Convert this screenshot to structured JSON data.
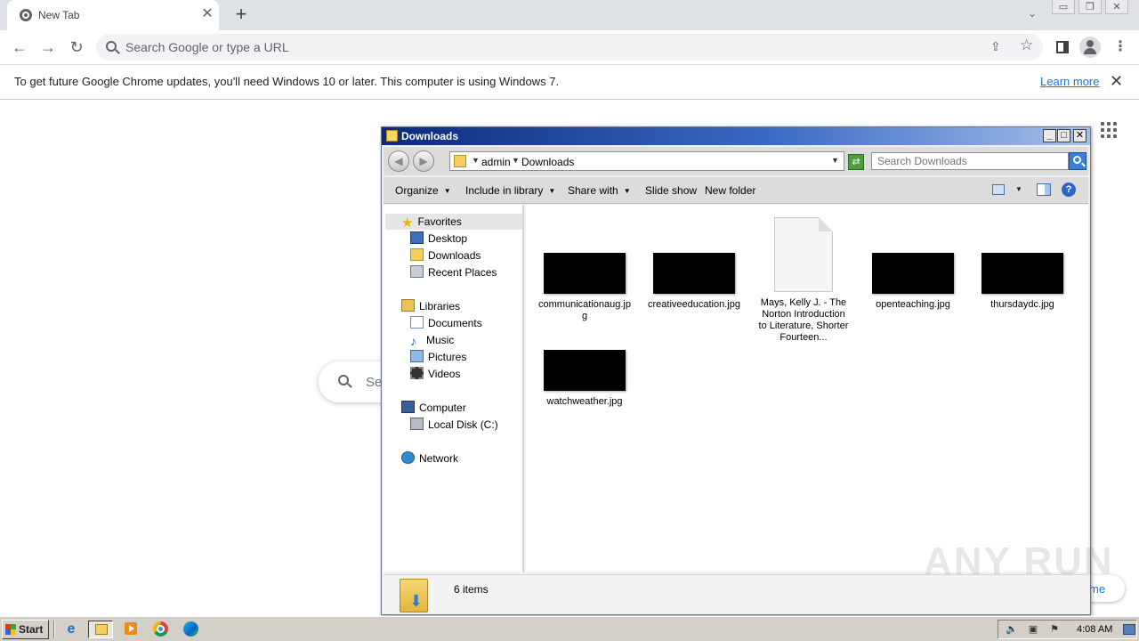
{
  "browser": {
    "tab_title": "New Tab",
    "omnibox_placeholder": "Search Google or type a URL",
    "infobar_text": "To get future Google Chrome updates, you'll need Windows 10 or later. This computer is using Windows 7.",
    "infobar_link": "Learn more"
  },
  "ntp": {
    "search_placeholder_partial": "Se",
    "customize_partial": "me"
  },
  "explorer": {
    "title": "Downloads",
    "breadcrumb": [
      "admin",
      "Downloads"
    ],
    "search_placeholder": "Search Downloads",
    "commands": {
      "organize": "Organize",
      "include": "Include in library",
      "share": "Share with",
      "slideshow": "Slide show",
      "newfolder": "New folder"
    },
    "nav": {
      "favorites": "Favorites",
      "desktop": "Desktop",
      "downloads": "Downloads",
      "recent": "Recent Places",
      "libraries": "Libraries",
      "documents": "Documents",
      "music": "Music",
      "pictures": "Pictures",
      "videos": "Videos",
      "computer": "Computer",
      "localdisk": "Local Disk (C:)",
      "network": "Network"
    },
    "files": [
      {
        "name": "communicationaug.jpg"
      },
      {
        "name": "creativeeducation.jpg"
      },
      {
        "name": "Mays, Kelly J. - The Norton Introduction to Literature, Shorter Fourteen..."
      },
      {
        "name": "openteaching.jpg"
      },
      {
        "name": "thursdaydc.jpg"
      },
      {
        "name": "watchweather.jpg"
      }
    ],
    "item_count": "6 items"
  },
  "taskbar": {
    "start_label": "Start",
    "clock": "4:08 AM"
  },
  "watermark": "ANY RUN"
}
